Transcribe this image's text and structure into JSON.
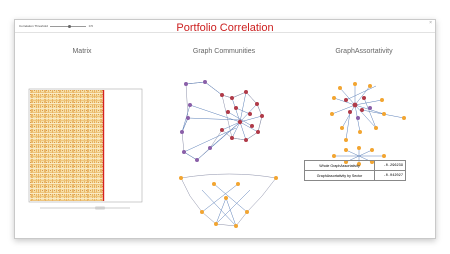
{
  "toolbar": {
    "threshold_label": "Correlation Threshold",
    "threshold_value": "0.5",
    "threshold_fraction": 0.55,
    "close_glyph": "×"
  },
  "title": "Portfolio Correlation",
  "panels": {
    "matrix": "Matrix",
    "communities": "Graph Communities",
    "assortativity": "GraphAssortativity"
  },
  "table": {
    "rows": [
      {
        "label": "Whole GraphAssortativity",
        "value": "-0.296239"
      },
      {
        "label": "GraphAssortativity by Sector",
        "value": "-0.042027"
      }
    ]
  },
  "colors": {
    "title": "#cc1f1f",
    "node_red": "#b03a48",
    "node_purple": "#8a5fa8",
    "node_orange": "#f2a531",
    "edge_blue": "#5b7fb8",
    "matrix_line": "#d42020"
  }
}
